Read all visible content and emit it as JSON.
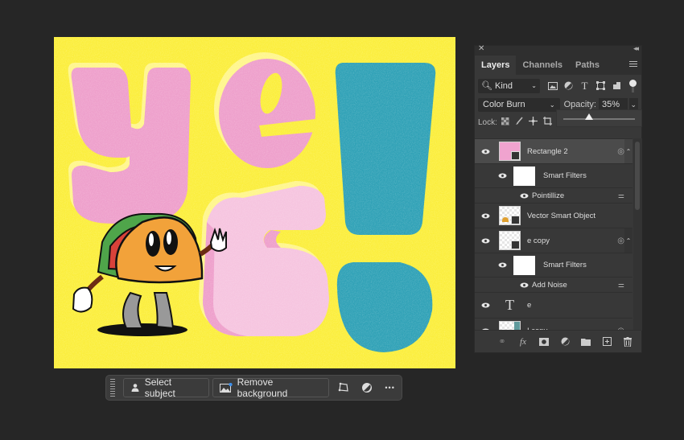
{
  "canvas": {
    "artwork_text": "yes!",
    "colors": {
      "background": "#fbee3c",
      "pink": "#f0a7cf",
      "light_pink": "#f7c6e2",
      "teal": "#2fa1b6",
      "taco": "#f2a23a"
    }
  },
  "taskbar": {
    "select_subject": "Select subject",
    "remove_background": "Remove background",
    "more": "•••"
  },
  "panel": {
    "tabs": [
      {
        "label": "Layers",
        "active": true
      },
      {
        "label": "Channels",
        "active": false
      },
      {
        "label": "Paths",
        "active": false
      }
    ],
    "filter_kind": "Kind",
    "blend_mode": "Color Burn",
    "opacity_label": "Opacity:",
    "opacity_value": "35%",
    "opacity_slider_fraction": 0.35,
    "lock_label": "Lock:",
    "layers": [
      {
        "name": "Rectangle 2",
        "type": "smart-object",
        "selected": true,
        "thumb": "#f0a3cf"
      },
      {
        "name": "Smart Filters",
        "type": "smart-filters"
      },
      {
        "name": "Pointillize",
        "type": "filter"
      },
      {
        "name": "Vector Smart Object",
        "type": "smart-object"
      },
      {
        "name": "e copy",
        "type": "smart-object"
      },
      {
        "name": "Smart Filters",
        "type": "smart-filters"
      },
      {
        "name": "Add Noise",
        "type": "filter"
      },
      {
        "name": "e",
        "type": "text"
      },
      {
        "name": "I copy",
        "type": "smart-object"
      }
    ]
  }
}
